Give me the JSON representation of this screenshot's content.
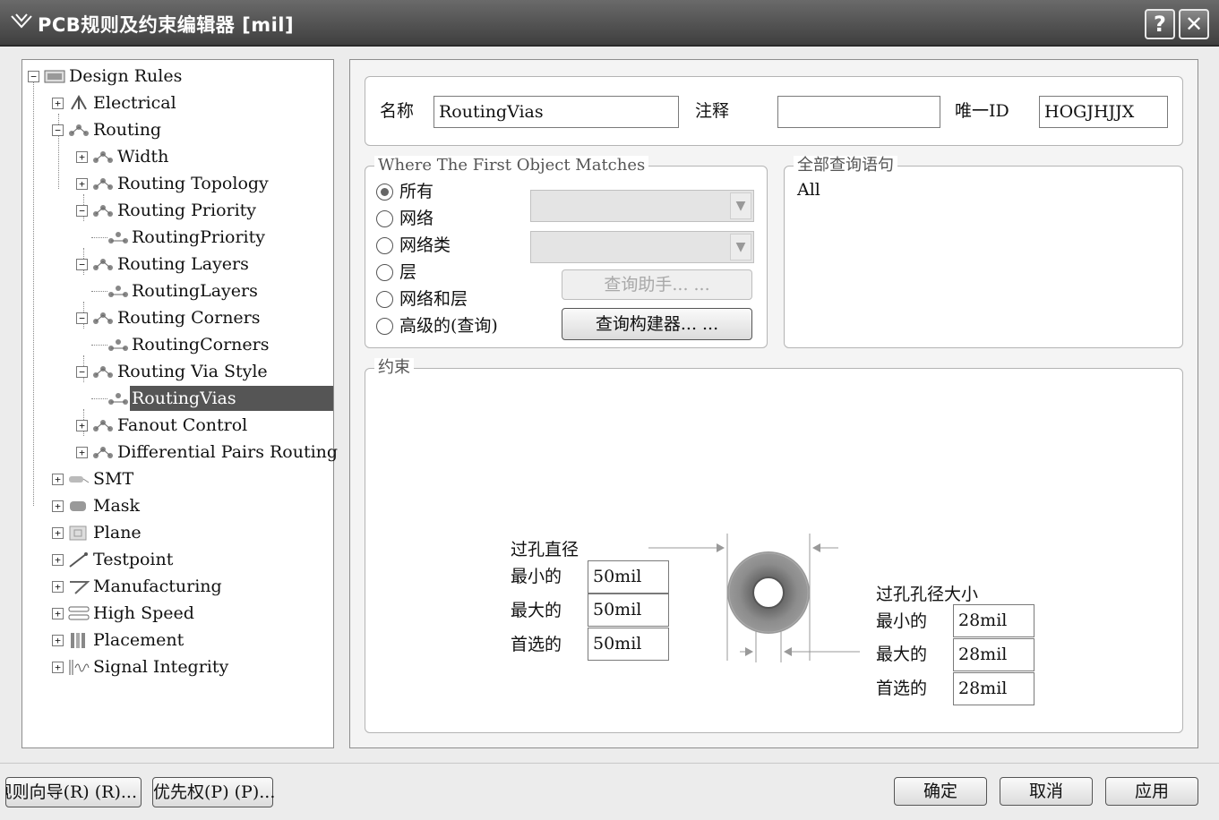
{
  "window": {
    "title": "PCB规则及约束编辑器 [mil]",
    "help_label": "?",
    "close_label": "✕"
  },
  "tree": {
    "items": [
      {
        "label": "Design Rules",
        "icon": "design-rules-icon",
        "expander": "−"
      },
      {
        "label": "Electrical",
        "icon": "electrical-icon",
        "expander": "+"
      },
      {
        "label": "Routing",
        "icon": "routing-icon",
        "expander": "−"
      },
      {
        "label": "Width",
        "icon": "routing-icon",
        "expander": "+"
      },
      {
        "label": "Routing Topology",
        "icon": "routing-icon",
        "expander": "+"
      },
      {
        "label": "Routing Priority",
        "icon": "routing-icon",
        "expander": "−"
      },
      {
        "label": "RoutingPriority",
        "icon": "rule-icon",
        "expander": ""
      },
      {
        "label": "Routing Layers",
        "icon": "routing-icon",
        "expander": "−"
      },
      {
        "label": "RoutingLayers",
        "icon": "rule-icon",
        "expander": ""
      },
      {
        "label": "Routing Corners",
        "icon": "routing-icon",
        "expander": "−"
      },
      {
        "label": "RoutingCorners",
        "icon": "rule-icon",
        "expander": ""
      },
      {
        "label": "Routing Via Style",
        "icon": "routing-icon",
        "expander": "−"
      },
      {
        "label": "RoutingVias",
        "icon": "rule-icon",
        "expander": "",
        "selected": true
      },
      {
        "label": "Fanout Control",
        "icon": "routing-icon",
        "expander": "+"
      },
      {
        "label": "Differential Pairs Routing",
        "icon": "routing-icon",
        "expander": "+"
      },
      {
        "label": "SMT",
        "icon": "smt-icon",
        "expander": "+"
      },
      {
        "label": "Mask",
        "icon": "mask-icon",
        "expander": "+"
      },
      {
        "label": "Plane",
        "icon": "plane-icon",
        "expander": "+"
      },
      {
        "label": "Testpoint",
        "icon": "testpoint-icon",
        "expander": "+"
      },
      {
        "label": "Manufacturing",
        "icon": "manufacturing-icon",
        "expander": "+"
      },
      {
        "label": "High Speed",
        "icon": "high-speed-icon",
        "expander": "+"
      },
      {
        "label": "Placement",
        "icon": "placement-icon",
        "expander": "+"
      },
      {
        "label": "Signal Integrity",
        "icon": "signal-integrity-icon",
        "expander": "+"
      }
    ]
  },
  "header": {
    "name_label": "名称",
    "name_value": "RoutingVias",
    "comment_label": "注释",
    "comment_value": "",
    "uid_label": "唯一ID",
    "uid_value": "HOGJHJJX"
  },
  "match": {
    "title": "Where The First Object Matches",
    "options": [
      "所有",
      "网络",
      "网络类",
      "层",
      "网络和层",
      "高级的(查询)"
    ],
    "selected_index": 0,
    "query_helper_label": "查询助手... ...",
    "query_builder_label": "查询构建器... ..."
  },
  "full_query": {
    "title": "全部查询语句",
    "text": "All"
  },
  "constraints": {
    "title": "约束",
    "via_diameter": {
      "title": "过孔直径",
      "min_label": "最小的",
      "min_value": "50mil",
      "max_label": "最大的",
      "max_value": "50mil",
      "pref_label": "首选的",
      "pref_value": "50mil"
    },
    "hole_size": {
      "title": "过孔孔径大小",
      "min_label": "最小的",
      "min_value": "28mil",
      "max_label": "最大的",
      "max_value": "28mil",
      "pref_label": "首选的",
      "pref_value": "28mil"
    }
  },
  "footer": {
    "wizard_label": "规则向导(R) (R)...",
    "priority_label": "优先权(P) (P)...",
    "ok_label": "确定",
    "cancel_label": "取消",
    "apply_label": "应用"
  }
}
